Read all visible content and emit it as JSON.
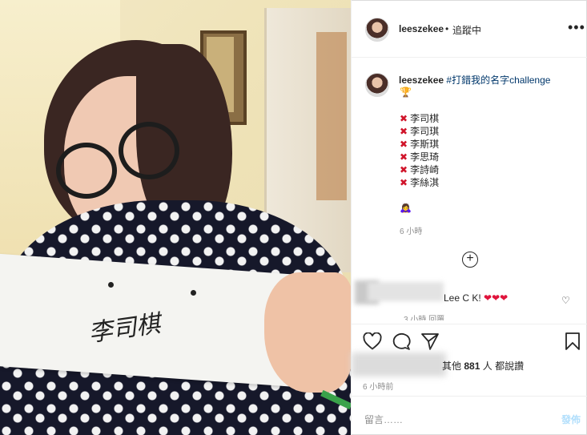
{
  "header": {
    "username": "leeszekee",
    "separator": "•",
    "follow_label": "追蹤中",
    "more": "•••"
  },
  "caption": {
    "username": "leeszekee",
    "hashtag": "#打錯我的名字challenge",
    "trophy": "🏆",
    "names": [
      {
        "mark": "✖",
        "text": "李司棋"
      },
      {
        "mark": "✖",
        "text": "李司琪"
      },
      {
        "mark": "✖",
        "text": "李斯琪"
      },
      {
        "mark": "✖",
        "text": "李思琦"
      },
      {
        "mark": "✖",
        "text": "李詩崎"
      },
      {
        "mark": "✖",
        "text": "李絲淇"
      }
    ],
    "emoji": "🙇‍♀️",
    "time": "6 小時"
  },
  "load_more": "+",
  "comment": {
    "text": "Lee C K!",
    "hearts": "❤❤❤",
    "like_icon": "♡",
    "meta": "3 小時   回覆"
  },
  "photo": {
    "signature": "李司棋"
  },
  "likes": {
    "prefix": "其他",
    "count": "881",
    "suffix": "人 都說讚"
  },
  "post_time": "6 小時前",
  "comment_input": {
    "placeholder": "留言……",
    "post_label": "發佈"
  },
  "icons": [
    "heart-icon",
    "comment-icon",
    "share-icon",
    "bookmark-icon"
  ]
}
